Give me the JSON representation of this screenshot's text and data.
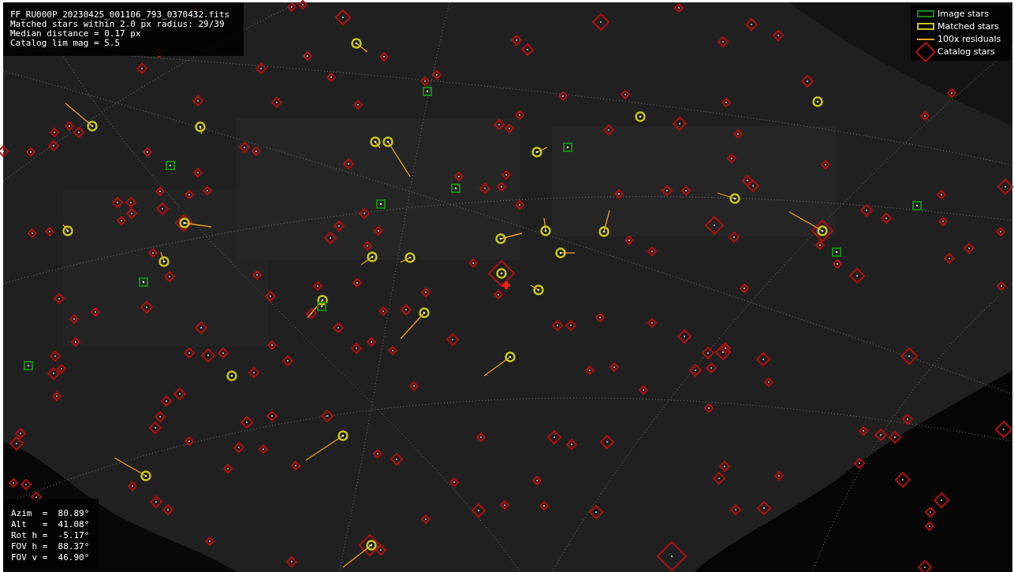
{
  "info_box": {
    "lines": [
      "FF_RU000P_20230425_001106_793_0370432.fits",
      "Matched stars within 2.0 px radius: 29/39",
      "Median distance = 0.17 px",
      "Catalog lim mag = 5.5"
    ]
  },
  "legend": {
    "items": [
      {
        "kind": "image",
        "label": "Image stars"
      },
      {
        "kind": "matched",
        "label": "Matched stars"
      },
      {
        "kind": "residual",
        "label": "100x residuals"
      },
      {
        "kind": "catalog",
        "label": "Catalog stars"
      }
    ]
  },
  "pointing_box": {
    "lines": [
      "Azim  =  80.89°",
      "Alt   =  41.08°",
      "Rot h =  -5.17°",
      "FOV h =  88.37°",
      "FOV v =  46.90°"
    ]
  }
}
